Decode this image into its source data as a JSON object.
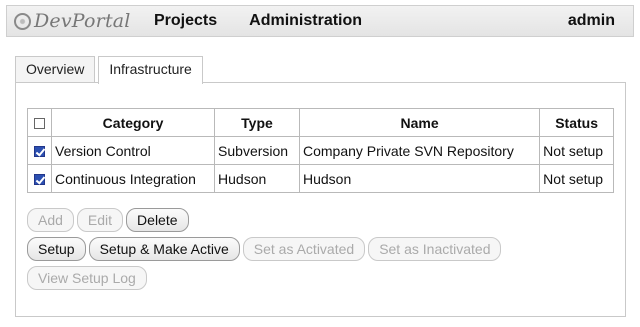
{
  "header": {
    "logo_text": "DevPortal",
    "nav": [
      "Projects",
      "Administration"
    ],
    "user": "admin"
  },
  "tabs": [
    {
      "label": "Overview",
      "active": false
    },
    {
      "label": "Infrastructure",
      "active": true
    }
  ],
  "table": {
    "columns": [
      "Category",
      "Type",
      "Name",
      "Status"
    ],
    "rows": [
      {
        "checked": true,
        "category": "Version Control",
        "type": "Subversion",
        "name": "Company Private SVN Repository",
        "status": "Not setup"
      },
      {
        "checked": true,
        "category": "Continuous Integration",
        "type": "Hudson",
        "name": "Hudson",
        "status": "Not setup"
      }
    ]
  },
  "buttons": {
    "add": "Add",
    "edit": "Edit",
    "delete": "Delete",
    "setup": "Setup",
    "setup_make_active": "Setup & Make Active",
    "set_activated": "Set as Activated",
    "set_inactivated": "Set as Inactivated",
    "view_setup_log": "View Setup Log"
  },
  "colors": {
    "checkbox_checked": "#2b4fb1",
    "disabled_text": "#aaaaaa"
  }
}
